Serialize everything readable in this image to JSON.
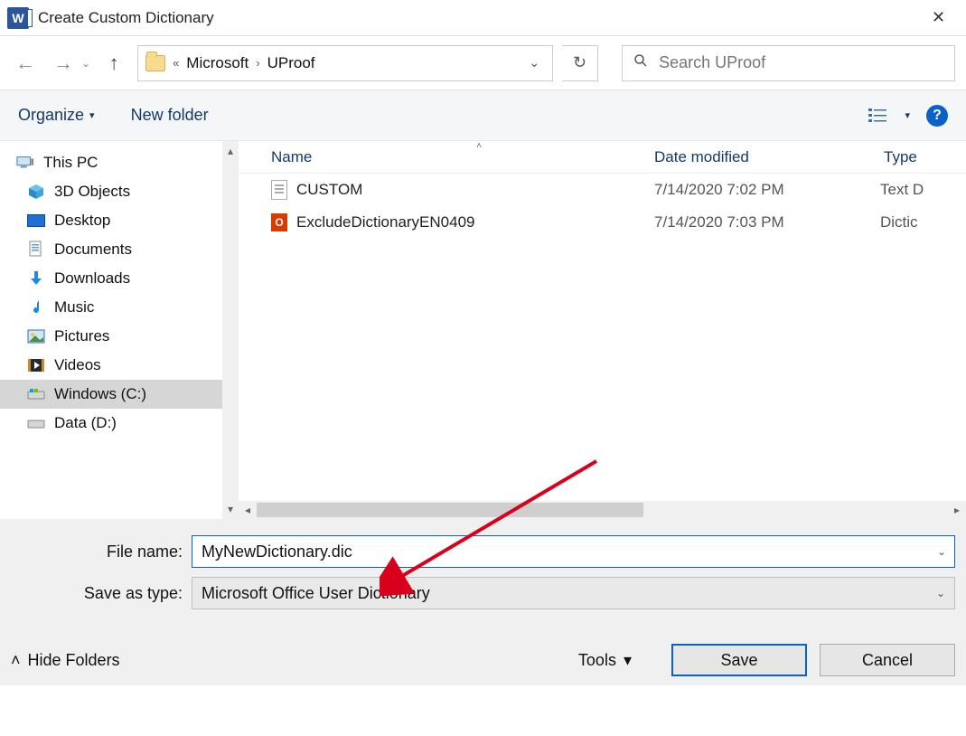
{
  "window": {
    "title": "Create Custom Dictionary"
  },
  "breadcrumb": {
    "prefix": "«",
    "parts": [
      "Microsoft",
      "UProof"
    ]
  },
  "search": {
    "placeholder": "Search UProof"
  },
  "toolbar": {
    "organize": "Organize",
    "new_folder": "New folder"
  },
  "columns": {
    "name": "Name",
    "date": "Date modified",
    "type": "Type"
  },
  "files": [
    {
      "name": "CUSTOM",
      "date": "7/14/2020 7:02 PM",
      "type": "Text D",
      "icon": "text"
    },
    {
      "name": "ExcludeDictionaryEN0409",
      "date": "7/14/2020 7:03 PM",
      "type": "Dictic",
      "icon": "office"
    }
  ],
  "tree": {
    "root": "This PC",
    "items": [
      {
        "label": "3D Objects",
        "icon": "cube"
      },
      {
        "label": "Desktop",
        "icon": "desktop"
      },
      {
        "label": "Documents",
        "icon": "doc"
      },
      {
        "label": "Downloads",
        "icon": "download"
      },
      {
        "label": "Music",
        "icon": "music"
      },
      {
        "label": "Pictures",
        "icon": "picture"
      },
      {
        "label": "Videos",
        "icon": "video"
      },
      {
        "label": "Windows (C:)",
        "icon": "drive",
        "selected": true
      },
      {
        "label": "Data (D:)",
        "icon": "drive"
      }
    ]
  },
  "fields": {
    "filename_label": "File name:",
    "filename_value": "MyNewDictionary.dic",
    "savetype_label": "Save as type:",
    "savetype_value": "Microsoft Office User Dictionary"
  },
  "footer": {
    "hide_folders": "Hide Folders",
    "tools": "Tools",
    "save": "Save",
    "cancel": "Cancel"
  }
}
